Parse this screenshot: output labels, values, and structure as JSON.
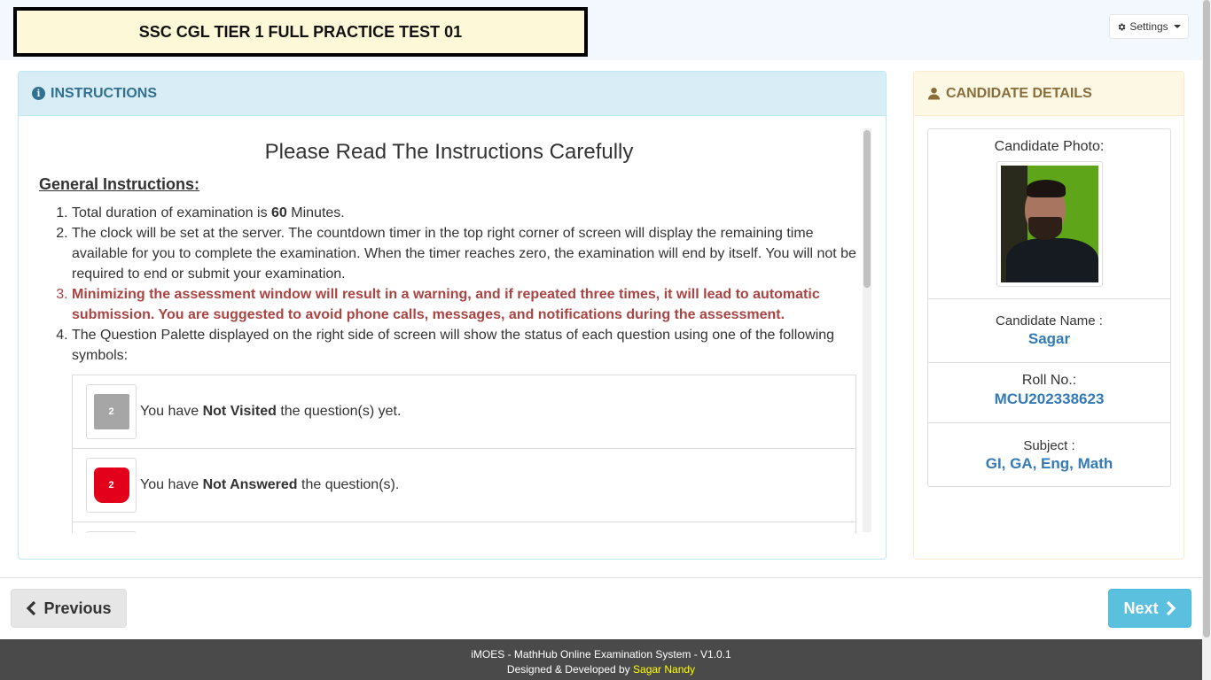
{
  "header": {
    "test_title": "SSC CGL TIER 1 FULL PRACTICE TEST 01",
    "settings_label": "Settings"
  },
  "instructions": {
    "panel_title": "INSTRUCTIONS",
    "heading": "Please Read The Instructions Carefully",
    "general_title": "General Instructions:",
    "item1_pre": "Total duration of examination is ",
    "item1_bold": "60",
    "item1_post": " Minutes.",
    "item2": "The clock will be set at the server. The countdown timer in the top right corner of screen will display the remaining time available for you to complete the examination. When the timer reaches zero, the examination will end by itself. You will not be required to end or submit your examination.",
    "item3": "Minimizing the assessment window will result in a warning, and if repeated three times, it will lead to automatic submission. You are suggested to avoid phone calls, messages, and notifications during the assessment.",
    "item4": "The Question Palette displayed on the right side of screen will show the status of each question using one of the following symbols:",
    "legend": [
      {
        "badge": "2",
        "pre": "You have ",
        "bold": "Not Visited",
        "post": " the question(s) yet.",
        "color": "#a6a6a6"
      },
      {
        "badge": "2",
        "pre": "You have ",
        "bold": "Not Answered",
        "post": " the question(s).",
        "color": "#e2001a"
      }
    ]
  },
  "candidate": {
    "panel_title": "CANDIDATE DETAILS",
    "photo_label": "Candidate Photo:",
    "name_label": "Candidate Name :",
    "name_value": "Sagar",
    "roll_label": "Roll No.:",
    "roll_value": "MCU202338623",
    "subject_label": "Subject :",
    "subject_value": "GI, GA, Eng, Math"
  },
  "nav": {
    "previous_label": "Previous",
    "next_label": "Next"
  },
  "footer": {
    "line1": "iMOES - MathHub Online Examination System - V1.0.1",
    "line2_pre": "Designed & Developed by ",
    "developer": "Sagar Nandy"
  },
  "colors": {
    "info_panel": "#d9edf7",
    "warning_panel": "#fcf8e3",
    "accent_blue": "#337ab7",
    "next_button": "#5bc0de",
    "warning_text": "#a94442"
  }
}
